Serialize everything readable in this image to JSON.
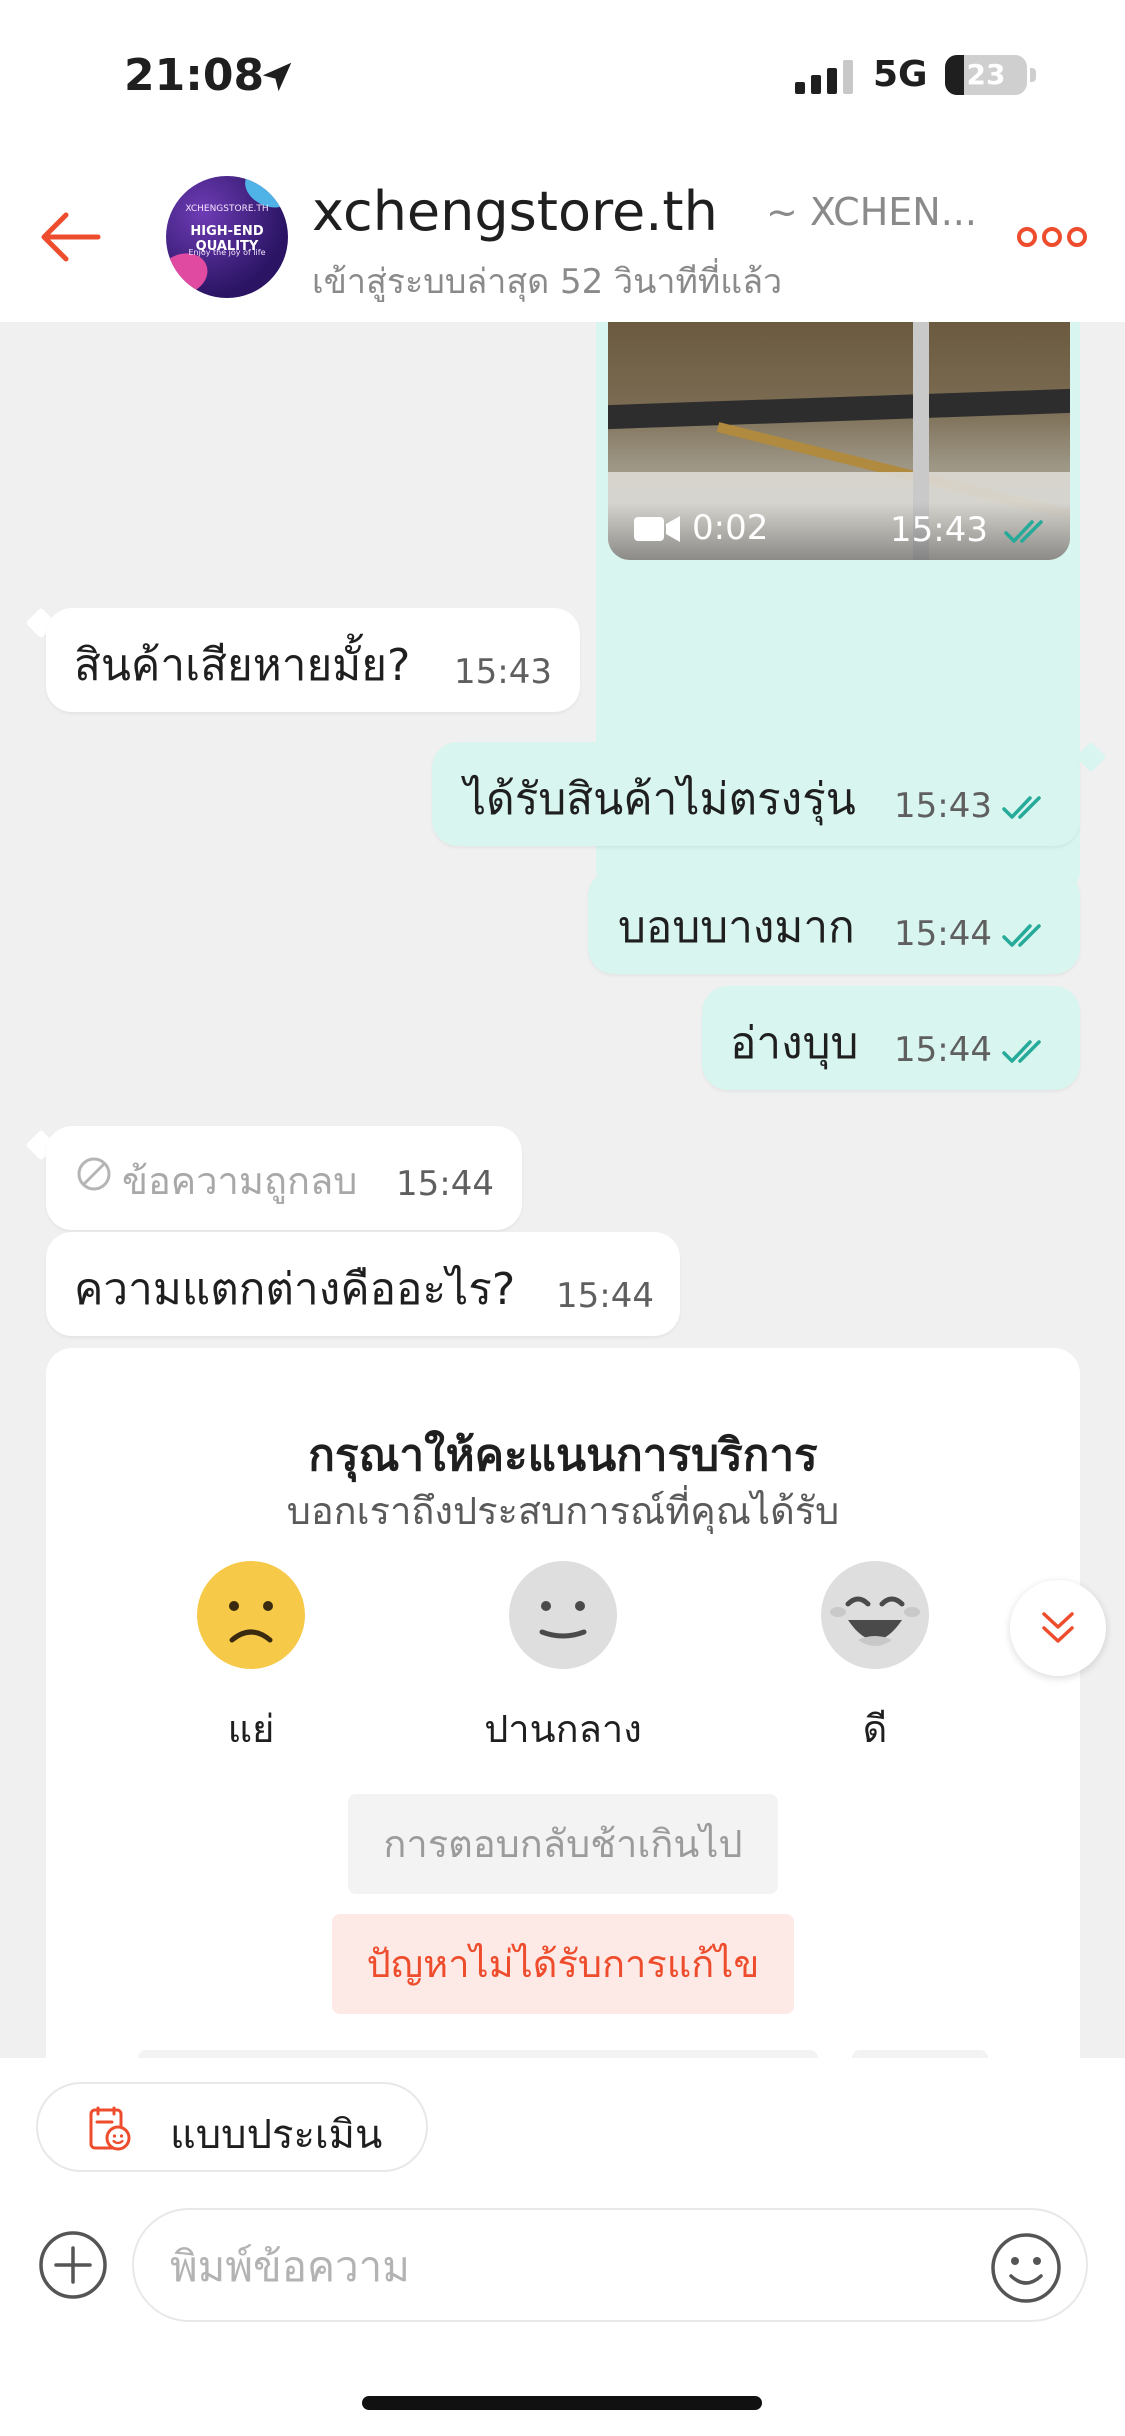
{
  "status_bar": {
    "time": "21:08",
    "network": "5G",
    "battery": "23",
    "battery_level": 0.23
  },
  "header": {
    "shop_name": "xchengstore.th",
    "shop_sub": "~ XCHEN...",
    "last_seen": "เข้าสู่ระบบล่าสุด 52 วินาทีที่แล้ว",
    "avatar": {
      "line1": "XCHENGSTORE.TH",
      "line2": "HIGH-END QUALITY",
      "line3": "Enjoy the joy of life"
    },
    "accent": "#ee4d2d"
  },
  "video_message": {
    "duration": "0:02",
    "time": "15:43"
  },
  "messages": [
    {
      "direction": "in",
      "text": "สินค้าเสียหายมั้ย?",
      "time": "15:43"
    },
    {
      "direction": "out",
      "text": "ได้รับสินค้าไม่ตรงรุ่น",
      "time": "15:43"
    },
    {
      "direction": "out",
      "text": "บอบบางมาก",
      "time": "15:44"
    },
    {
      "direction": "out",
      "text": "อ่างบุบ",
      "time": "15:44"
    },
    {
      "direction": "in",
      "deleted": true,
      "text": "ข้อความถูกลบ",
      "time": "15:44"
    },
    {
      "direction": "in",
      "text": "ความแตกต่างคืออะไร?",
      "time": "15:44"
    }
  ],
  "rating": {
    "title": "กรุณาให้คะแนนการบริการ",
    "subtitle": "บอกเราถึงประสบการณ์ที่คุณได้รับ",
    "options": [
      {
        "label": "แย่",
        "icon": "sad-face-icon",
        "selected": true,
        "color": "#f7c948"
      },
      {
        "label": "ปานกลาง",
        "icon": "neutral-face-icon",
        "selected": false,
        "color": "#dedede"
      },
      {
        "label": "ดี",
        "icon": "happy-face-icon",
        "selected": false,
        "color": "#dedede"
      }
    ],
    "reasons": [
      {
        "label": "การตอบกลับช้าเกินไป",
        "selected": false
      },
      {
        "label": "ปัญหาไม่ได้รับการแก้ไข",
        "selected": true
      }
    ]
  },
  "bottom_bar": {
    "eval_label": "แบบประเมิน",
    "input_placeholder": "พิมพ์ข้อความ",
    "input_value": ""
  },
  "colors": {
    "outgoing_bubble": "#d8f5ef",
    "incoming_bubble": "#ffffff",
    "read_check": "#26aa99",
    "chat_background": "#f0f0f0"
  }
}
